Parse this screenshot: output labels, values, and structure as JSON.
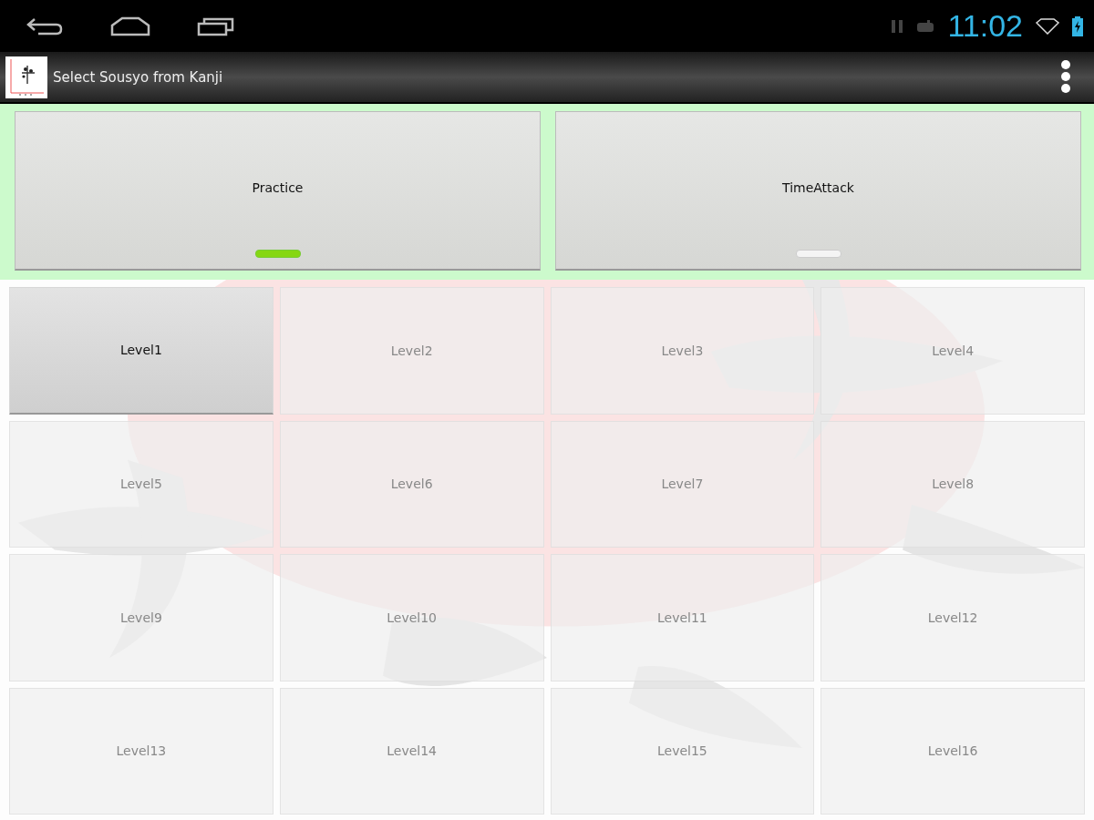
{
  "status_bar": {
    "time": "11:02"
  },
  "action_bar": {
    "title": "Select Sousyo from Kanji"
  },
  "modes": [
    {
      "label": "Practice",
      "selected": true
    },
    {
      "label": "TimeAttack",
      "selected": false
    }
  ],
  "levels": [
    {
      "label": "Level1",
      "selected": true
    },
    {
      "label": "Level2",
      "selected": false
    },
    {
      "label": "Level3",
      "selected": false
    },
    {
      "label": "Level4",
      "selected": false
    },
    {
      "label": "Level5",
      "selected": false
    },
    {
      "label": "Level6",
      "selected": false
    },
    {
      "label": "Level7",
      "selected": false
    },
    {
      "label": "Level8",
      "selected": false
    },
    {
      "label": "Level9",
      "selected": false
    },
    {
      "label": "Level10",
      "selected": false
    },
    {
      "label": "Level11",
      "selected": false
    },
    {
      "label": "Level12",
      "selected": false
    },
    {
      "label": "Level13",
      "selected": false
    },
    {
      "label": "Level14",
      "selected": false
    },
    {
      "label": "Level15",
      "selected": false
    },
    {
      "label": "Level16",
      "selected": false
    }
  ]
}
